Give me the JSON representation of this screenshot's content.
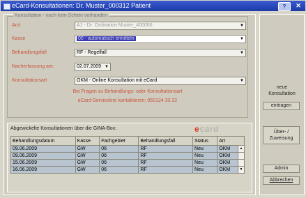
{
  "window": {
    "title": "eCard-Konsultationen: Dr. Muster_000312 Patient",
    "help_label": "?",
    "close_label": "✕"
  },
  "group": {
    "legend": "Konsultation - noch kein Schein vorhanden",
    "arzt_label": "Arzt",
    "arzt_value": "A1 - Dr. Ordination Muster_400000",
    "kasse_label": "Kasse",
    "kasse_value": "00 - automatisch ermitteln",
    "behandlungsfall_label": "Behandlungsfall",
    "behandlungsfall_value": "RF - Regelfall",
    "nacherfassung_label": "Nacherfassung am:",
    "nacherfassung_value": "02.07.2009",
    "konsultationsart_label": "Konsultationsart",
    "konsultationsart_value": "OKM - Online Konsultation mit eCard",
    "note_line1": "Bei Fragen zu Behandlungs- oder Konsultationsart",
    "note_line2": "eCard-Serviceline kontaktieren: 050124 33 22"
  },
  "consultations": {
    "heading": "Abgewickelte Konsultationen über die GINA-Box:",
    "logo_e": "e",
    "logo_rest": "card",
    "columns": [
      "Behandlungsdatum",
      "Kasse",
      "Fachgebiet",
      "Behandlungsfall",
      "Status",
      "Art"
    ],
    "rows": [
      [
        "09.06.2009",
        "GW",
        "06",
        "RF",
        "Neu",
        "OKM"
      ],
      [
        "09.06.2009",
        "GW",
        "06",
        "RF",
        "Neu",
        "OKM"
      ],
      [
        "15.06.2009",
        "GW",
        "06",
        "RF",
        "Neu",
        "OKM"
      ],
      [
        "16.06.2009",
        "GW",
        "06",
        "RF",
        "Neu",
        "OKM"
      ]
    ]
  },
  "sidebar": {
    "neue_line1": "neue",
    "neue_line2": "Konsultation",
    "eintragen_label": "eintragen",
    "ueber_line1": "Über- /",
    "ueber_line2": "Zuweisung",
    "admin_label": "Admin",
    "abbrechen_label": "Abbrechen"
  }
}
